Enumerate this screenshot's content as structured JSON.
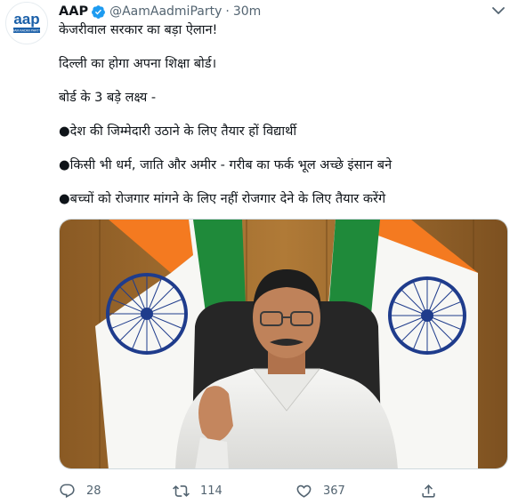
{
  "account": {
    "avatar_text": "aap",
    "avatar_subtext": "AAM AADMI PARTY",
    "name": "AAP",
    "handle": "@AamAadmiParty",
    "separator": "·",
    "time": "30m"
  },
  "tweet": {
    "lines": [
      "केजरीवाल सरकार का बड़ा ऐलान!",
      "दिल्ली का होगा अपना शिक्षा बोर्ड।",
      "बोर्ड के 3 बड़े लक्ष्य -",
      "●देश की जिम्मेदारी उठाने के लिए तैयार हों विद्यार्थी",
      "●किसी भी धर्म, जाति और अमीर - गरीब का फर्क भूल अच्छे इंसान बने",
      "●बच्चों को रोजगार मांगने के लिए नहीं रोजगार देने के लिए तैयार करेंगे"
    ]
  },
  "actions": {
    "replies": "28",
    "retweets": "114",
    "likes": "367"
  },
  "icons": {
    "verified": "verified-badge-icon",
    "more": "more-options-icon",
    "reply": "reply-icon",
    "retweet": "retweet-icon",
    "like": "heart-icon",
    "share": "share-icon"
  },
  "colors": {
    "accent": "#1d9bf0",
    "brand": "#1a5fa8",
    "muted": "#536471",
    "saffron": "#f47a20",
    "green": "#1f8a3a",
    "chakra_blue": "#1f3c8c"
  }
}
